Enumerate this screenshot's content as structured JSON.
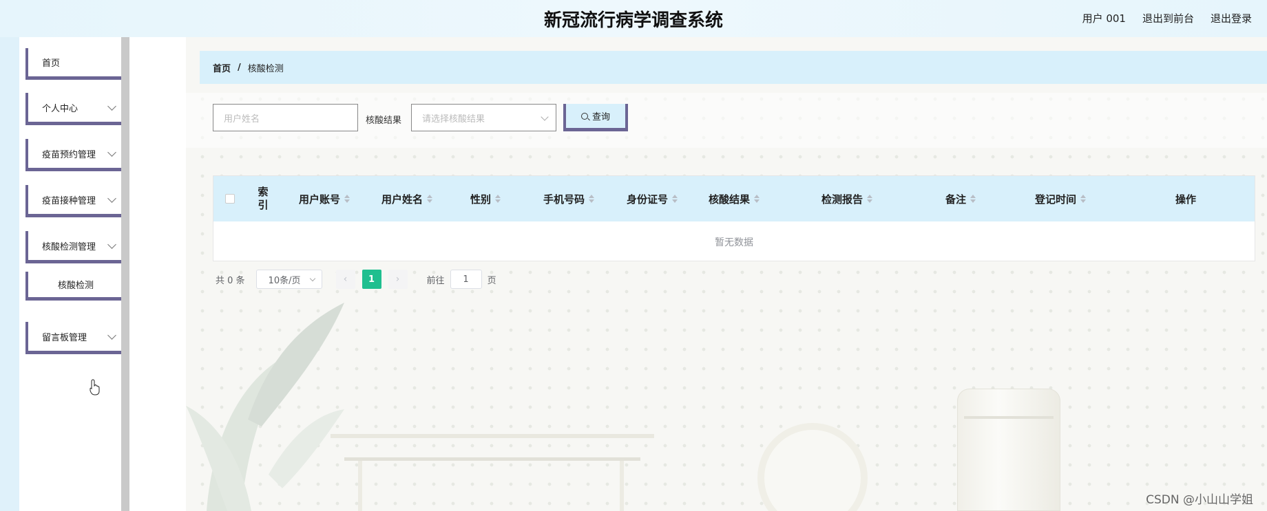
{
  "header": {
    "title": "新冠流行病学调查系统",
    "user": "用户 001",
    "back_to_front": "退出到前台",
    "logout": "退出登录"
  },
  "sidebar": {
    "items": [
      {
        "label": "首页"
      },
      {
        "label": "个人中心"
      },
      {
        "label": "疫苗预约管理"
      },
      {
        "label": "疫苗接种管理"
      },
      {
        "label": "核酸检测管理"
      },
      {
        "label": "核酸检测"
      },
      {
        "label": "留言板管理"
      }
    ]
  },
  "breadcrumb": {
    "home": "首页",
    "separator": "/",
    "current": "核酸检测"
  },
  "search": {
    "name_placeholder": "用户姓名",
    "result_label": "核酸结果",
    "result_placeholder": "请选择核酸结果",
    "query_label": "查询"
  },
  "table": {
    "columns": [
      "索\n引",
      "用户账号",
      "用户姓名",
      "性别",
      "手机号码",
      "身份证号",
      "核酸结果",
      "检测报告",
      "备注",
      "登记时间",
      "操作"
    ],
    "empty_text": "暂无数据"
  },
  "pagination": {
    "total": "共 0 条",
    "page_size": "10条/页",
    "prev": "‹",
    "current_page": "1",
    "next": "›",
    "goto_label": "前往",
    "goto_value": "1",
    "page_unit": "页"
  },
  "watermark": "CSDN @小山山学姐",
  "colors": {
    "accent_border": "#6b6594",
    "header_bg": "#d8f0fb",
    "active_page": "#1fbf8f"
  }
}
